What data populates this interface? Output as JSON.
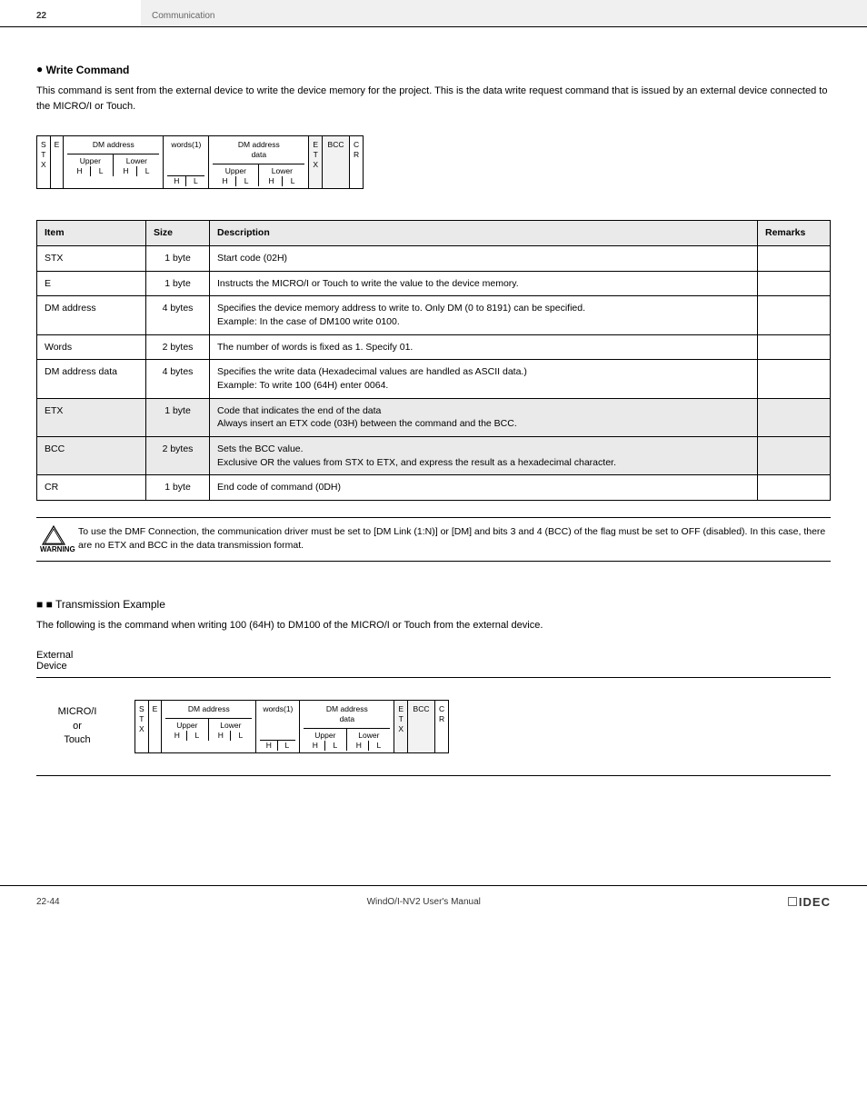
{
  "header": {
    "chapter": "22",
    "chapter_title": "Communication"
  },
  "section1": {
    "bullet": "●",
    "title": "Write Command",
    "intro": "This command is sent from the external device to write the device memory for the project. This is the data write request command that is issued by an external device connected to the MICRO/I or Touch."
  },
  "frame": {
    "stx": "S\nT\nX",
    "e": "E",
    "dm_addr": "DM address",
    "upper": "Upper",
    "lower": "Lower",
    "h": "H",
    "l": "L",
    "words": "words(1)",
    "dm_data": "DM address\ndata",
    "etx": "E\nT\nX",
    "bcc": "BCC",
    "cr": "C\nR"
  },
  "table": {
    "th_item": "Item",
    "th_size": "Size",
    "th_desc": "Description",
    "th_remarks": "Remarks",
    "rows": [
      {
        "item": "STX",
        "size": "1 byte",
        "desc": "Start code (02H)",
        "g": false
      },
      {
        "item": "E",
        "size": "1 byte",
        "desc": "Instructs the MICRO/I or Touch to write the value to the device memory.",
        "g": false
      },
      {
        "item": "DM address",
        "size": "4 bytes",
        "desc": "Specifies the device memory address to write to. Only DM (0 to 8191) can be specified.\nExample: In the case of DM100 write 0100.",
        "g": false
      },
      {
        "item": "Words",
        "size": "2 bytes",
        "desc": "The number of words is fixed as 1. Specify 01.",
        "g": false
      },
      {
        "item": "DM address data",
        "size": "4 bytes",
        "desc": "Specifies the write data (Hexadecimal values are handled as ASCII data.)\nExample: To write 100 (64H) enter 0064.",
        "g": false
      },
      {
        "item": "ETX",
        "size": "1 byte",
        "desc": "Code that indicates the end of the data\nAlways insert an ETX code (03H) between the command and the BCC.",
        "g": true
      },
      {
        "item": "BCC",
        "size": "2 bytes",
        "desc": "Sets the BCC value.\nExclusive OR the values from STX to ETX, and express the result as a hexadecimal character.",
        "g": true
      },
      {
        "item": "CR",
        "size": "1 byte",
        "desc": "End code of command (0DH)",
        "g": false
      }
    ]
  },
  "warning": {
    "label": "WARNING",
    "text": "To use the DMF Connection, the communication driver must be set to [DM Link (1:N)] or [DM] and bits 3 and 4 (BCC) of the flag must be set to OFF (disabled). In this case, there are no ETX and BCC in the data transmission format.",
    "link_a": "[DM Link (1:N)]",
    "link_b": "[DM]"
  },
  "section2": {
    "title": "■ Transmission Example",
    "intro": "The following is the command when writing 100 (64H) to DM100 of the MICRO/I or Touch from the external device.",
    "left_label": "External\nDevice",
    "right_label": "MICRO/I\nor\nTouch"
  },
  "footer": {
    "page": "22-44",
    "manual": "WindO/I-NV2 User's Manual",
    "brand": "IDEC"
  }
}
